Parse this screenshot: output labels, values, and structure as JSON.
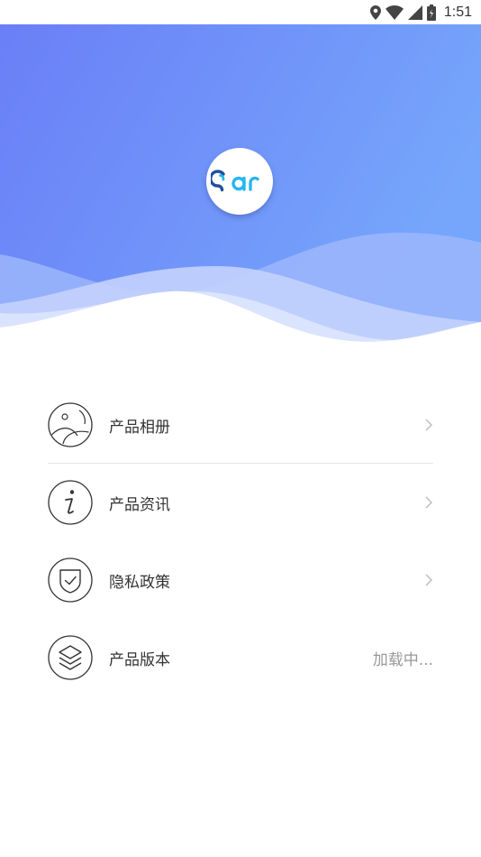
{
  "status_bar": {
    "time": "1:51",
    "icons": [
      "location-icon",
      "wifi-icon",
      "cellular-signal-icon",
      "battery-icon"
    ]
  },
  "header": {
    "logo_text": "ear",
    "colors": {
      "gradient_start": "#6a7ff7",
      "gradient_end": "#76a6fb"
    }
  },
  "menu": {
    "items": [
      {
        "label": "产品相册",
        "icon": "photo-album-icon",
        "accessory": "chevron"
      },
      {
        "label": "产品资讯",
        "icon": "info-icon",
        "accessory": "chevron"
      },
      {
        "label": "隐私政策",
        "icon": "shield-icon",
        "accessory": "chevron"
      },
      {
        "label": "产品版本",
        "icon": "layers-icon",
        "value": "加载中..."
      }
    ]
  }
}
